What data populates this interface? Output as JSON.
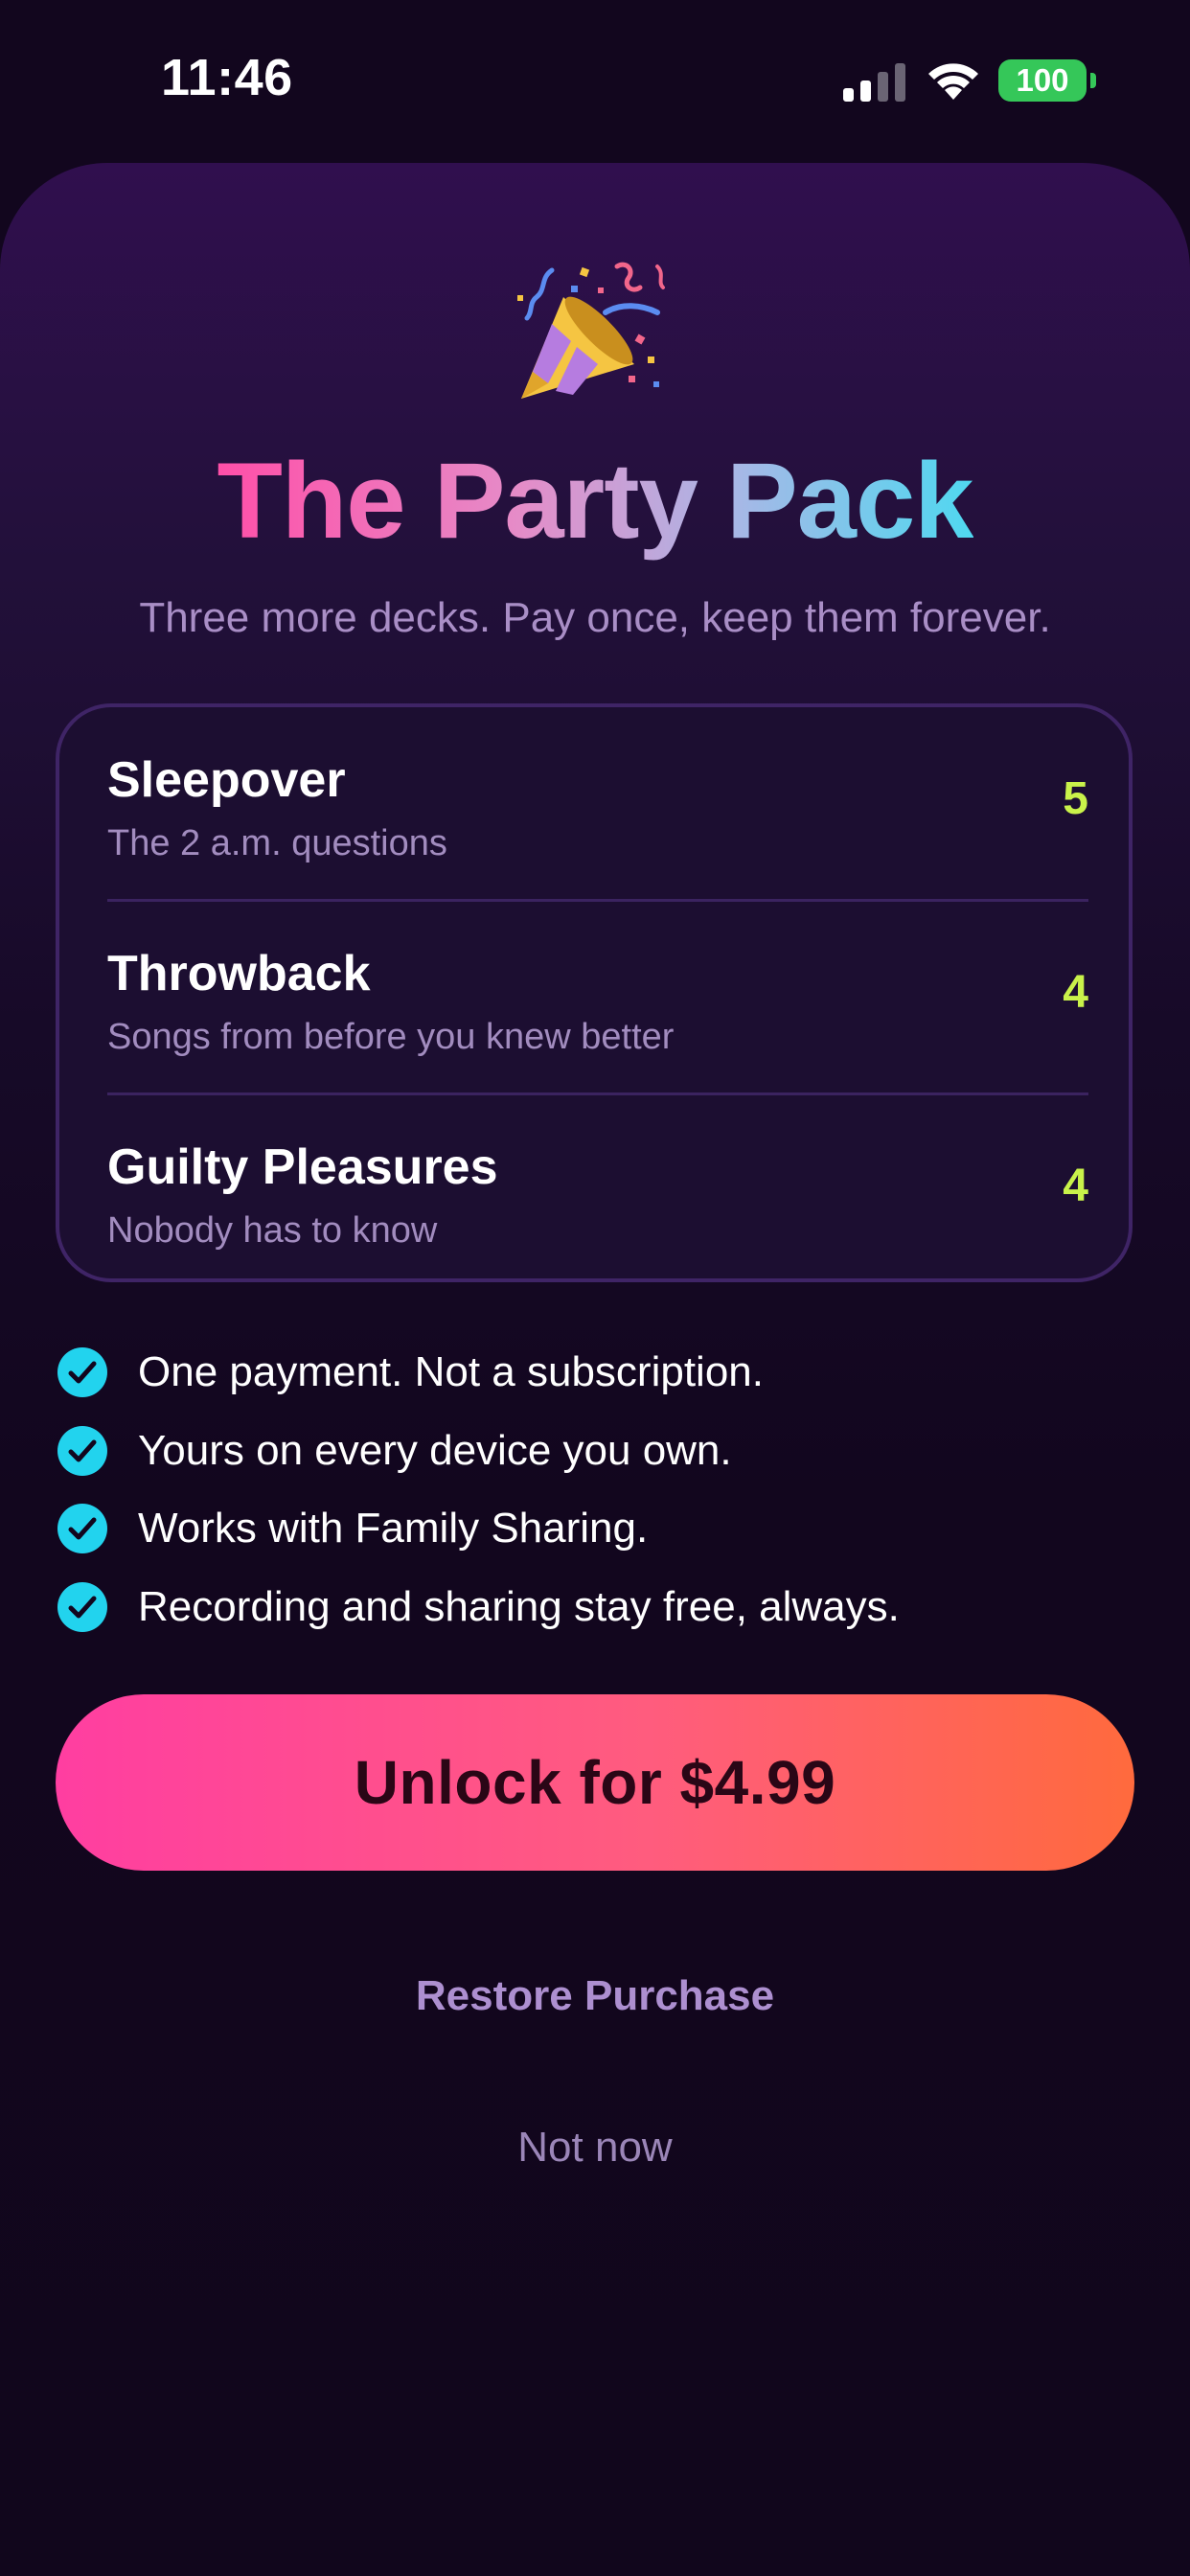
{
  "status_bar": {
    "time": "11:46",
    "battery_level": "100",
    "icons": [
      "signal-icon",
      "wifi-icon",
      "battery-icon"
    ]
  },
  "header": {
    "emoji_icon": "party-popper-icon",
    "title": "The Party Pack",
    "subtitle": "Three more decks. Pay once, keep them forever."
  },
  "decks": [
    {
      "name": "Sleepover",
      "description": "The 2 a.m. questions",
      "count": "5"
    },
    {
      "name": "Throwback",
      "description": "Songs from before you knew better",
      "count": "4"
    },
    {
      "name": "Guilty Pleasures",
      "description": "Nobody has to know",
      "count": "4"
    }
  ],
  "features": [
    "One payment. Not a subscription.",
    "Yours on every device you own.",
    "Works with Family Sharing.",
    "Recording and sharing stay free, always."
  ],
  "actions": {
    "unlock_label": "Unlock for $4.99",
    "restore_label": "Restore Purchase",
    "dismiss_label": "Not now"
  },
  "colors": {
    "background": "#12061e",
    "accent_count": "#c9f24a",
    "check": "#22d3ee",
    "button_start": "#ff3ea1",
    "button_end": "#ff6a3d",
    "battery": "#35c759"
  }
}
